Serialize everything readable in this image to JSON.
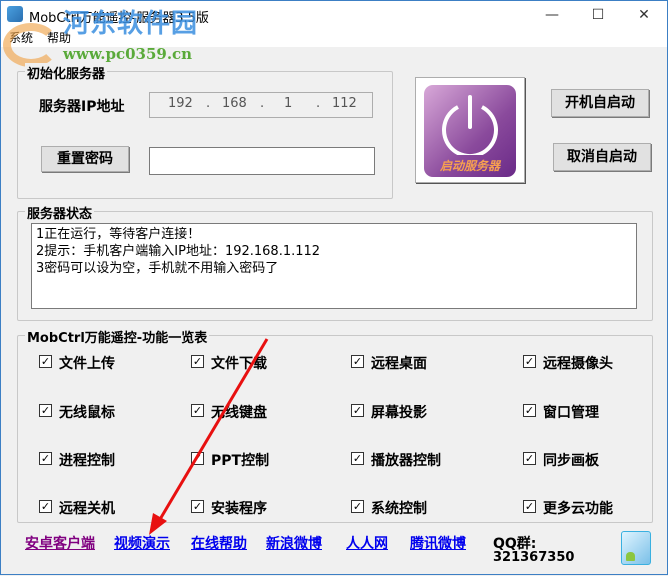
{
  "window": {
    "title": "MobCtrl万能遥控-服务器3.5版",
    "minimize": "—",
    "maximize": "☐",
    "close": "✕"
  },
  "watermark": {
    "site": "河东软件园",
    "url": "www.pc0359.cn"
  },
  "menu": [
    "系统",
    "帮助"
  ],
  "init": {
    "label": "初始化服务器",
    "ip_label": "服务器IP地址",
    "ip": [
      "192",
      "168",
      "1",
      "112"
    ],
    "reset_btn": "重置密码",
    "password": "",
    "start_caption": "启动服务器",
    "autostart_on": "开机自启动",
    "autostart_off": "取消自启动"
  },
  "status": {
    "label": "服务器状态",
    "lines": [
      "1正在运行，等待客户连接！",
      "2提示：手机客户端输入IP地址：192.168.1.112",
      "3密码可以设为空，手机就不用输入密码了"
    ]
  },
  "features": {
    "label": "MobCtrl万能遥控-功能一览表",
    "items": [
      "文件上传",
      "文件下载",
      "远程桌面",
      "远程摄像头",
      "无线鼠标",
      "无线键盘",
      "屏幕投影",
      "窗口管理",
      "进程控制",
      "PPT控制",
      "播放器控制",
      "同步画板",
      "远程关机",
      "安装程序",
      "系统控制",
      "更多云功能"
    ]
  },
  "links": [
    "安卓客户端",
    "视频演示",
    "在线帮助",
    "新浪微博",
    "人人网",
    "腾讯微博"
  ],
  "qq": {
    "label": "QQ群:",
    "number": "321367350"
  }
}
